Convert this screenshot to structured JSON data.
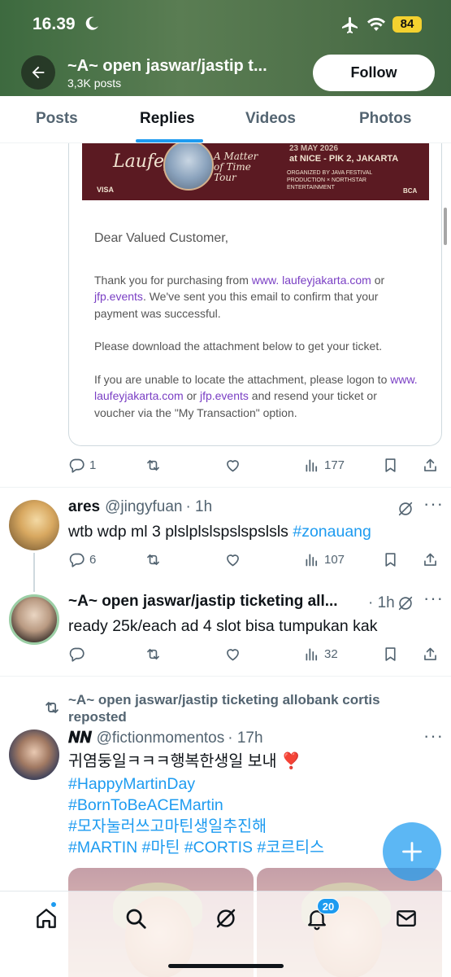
{
  "status_bar": {
    "time": "16.39",
    "battery": "84"
  },
  "header": {
    "title": "~A~ open jaswar/jastip t...",
    "posts_count": "3,3K posts",
    "follow_label": "Follow"
  },
  "tabs": [
    {
      "label": "Posts"
    },
    {
      "label": "Replies",
      "active": true
    },
    {
      "label": "Videos"
    },
    {
      "label": "Photos"
    }
  ],
  "email_banner": {
    "logo": "Laufey",
    "tour": "A Matter of Time Tour",
    "date": "23 MAY 2026",
    "venue": "at NICE - PIK 2, JAKARTA",
    "organizers": "ORGANIZED BY JAVA FESTIVAL PRODUCTION × NORTHSTAR ENTERTAINMENT",
    "visa": "VISA",
    "bca": "BCA"
  },
  "email": {
    "greeting": "Dear Valued Customer,",
    "p1_a": "Thank you for purchasing from ",
    "p1_link1": "www. laufeyjakarta.com",
    "p1_b": " or ",
    "p1_link2": "jfp.events",
    "p1_c": ". We've sent you this email to confirm that your payment was successful.",
    "p2": "Please download the attachment below to get your ticket.",
    "p3_a": "If you are unable to locate the attachment, please logon to ",
    "p3_link1": "www. laufeyjakarta.com",
    "p3_b": " or ",
    "p3_link2": "jfp.events",
    "p3_c": " and resend your ticket or voucher via the \"My Transaction\" option."
  },
  "post1_actions": {
    "replies": "1",
    "reposts": "",
    "likes": "",
    "views": "177"
  },
  "tweet_ares": {
    "name": "ares",
    "handle": "@jingyfuan",
    "time": "· 1h",
    "text": "wtb wdp ml 3 plslplslspslspslsls ",
    "hashtag": "#zonauang",
    "replies": "6",
    "views": "107"
  },
  "tweet_reply": {
    "name": "~A~ open jaswar/jastip ticketing all...",
    "time": "· 1h",
    "text": "ready 25k/each ad 4 slot bisa tumpukan kak",
    "replies": "",
    "views": "32"
  },
  "repost": {
    "label": "~A~ open jaswar/jastip ticketing allobank cortis reposted",
    "name": "𝑵𝑵",
    "handle": "@fictionmomentos",
    "time": "· 17h",
    "text": "귀염둥일ㅋㅋㅋ행복한생일 보내 ❣️",
    "hashtags": [
      "#HappyMartinDay",
      "#BornToBeACEMartin",
      "#모자눌러쓰고마틴생일추진해"
    ],
    "last_line": [
      "#MARTIN",
      "#마틴",
      "#CORTIS",
      "#코르티스"
    ]
  },
  "nav": {
    "notifications_badge": "20"
  },
  "icons": {
    "back": "back-arrow-icon",
    "reply": "reply-icon",
    "repost": "repost-icon",
    "like": "heart-icon",
    "views": "views-icon",
    "bookmark": "bookmark-icon",
    "share": "share-icon",
    "grok": "grok-icon",
    "home": "home-icon",
    "search": "search-icon",
    "bell": "bell-icon",
    "mail": "mail-icon",
    "compose": "plus-icon"
  },
  "colors": {
    "accent": "#1d9bf0",
    "link_purple": "#7a3fc4",
    "header_green": "#4e7049"
  }
}
